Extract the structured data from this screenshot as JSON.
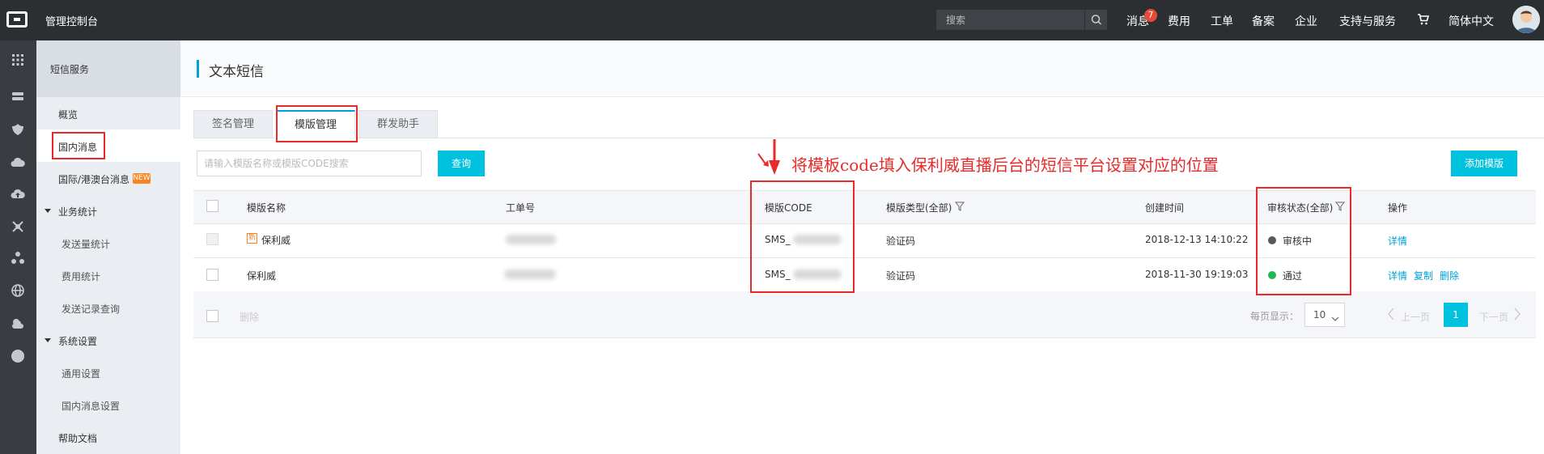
{
  "topbar": {
    "title": "管理控制台",
    "search_placeholder": "搜索",
    "nav": {
      "messages": "消息",
      "messages_count": "7",
      "cost": "费用",
      "ticket": "工单",
      "filing": "备案",
      "enterprise": "企业",
      "support": "支持与服务",
      "language": "简体中文"
    }
  },
  "sidebar": {
    "header": "短信服务",
    "items": {
      "overview": "概览",
      "domestic": "国内消息",
      "international": "国际/港澳台消息",
      "new_badge": "NEW",
      "stats_group": "业务统计",
      "send_stats": "发送量统计",
      "cost_stats": "费用统计",
      "send_records": "发送记录查询",
      "settings_group": "系统设置",
      "general_settings": "通用设置",
      "domestic_settings": "国内消息设置",
      "help": "帮助文档"
    }
  },
  "main": {
    "title": "文本短信",
    "tabs": {
      "signature": "签名管理",
      "template": "模版管理",
      "bulk": "群发助手"
    },
    "filter_placeholder": "请输入模版名称或模版CODE搜索",
    "query_label": "查询",
    "add_label": "添加模版",
    "annotation": "将模板code填入保利威直播后台的短信平台设置对应的位置"
  },
  "table": {
    "headers": {
      "name": "模版名称",
      "ticket": "工单号",
      "code": "模版CODE",
      "type": "模版类型(全部)",
      "created": "创建时间",
      "status": "审核状态(全部)",
      "actions": "操作"
    },
    "rows": [
      {
        "tag": "新",
        "name": "保利威",
        "code": "SMS_",
        "type": "验证码",
        "created": "2018-12-13 14:10:22",
        "status": "审核中",
        "status_color": "#595959",
        "action_detail": "详情"
      },
      {
        "name": "保利威",
        "code": "SMS_",
        "type": "验证码",
        "created": "2018-11-30 19:19:03",
        "status": "通过",
        "status_color": "#1fb84e",
        "action_detail": "详情",
        "action_copy": "复制",
        "action_delete": "删除"
      }
    ],
    "footer": {
      "delete": "删除",
      "per_page_label": "每页显示：",
      "per_page_value": "10",
      "prev": "上一页",
      "page": "1",
      "next": "下一页"
    }
  },
  "colors": {
    "accent": "#00c1de",
    "link": "#00a1d6",
    "annotation": "#e82a2a",
    "topbar": "#2c2f32"
  }
}
